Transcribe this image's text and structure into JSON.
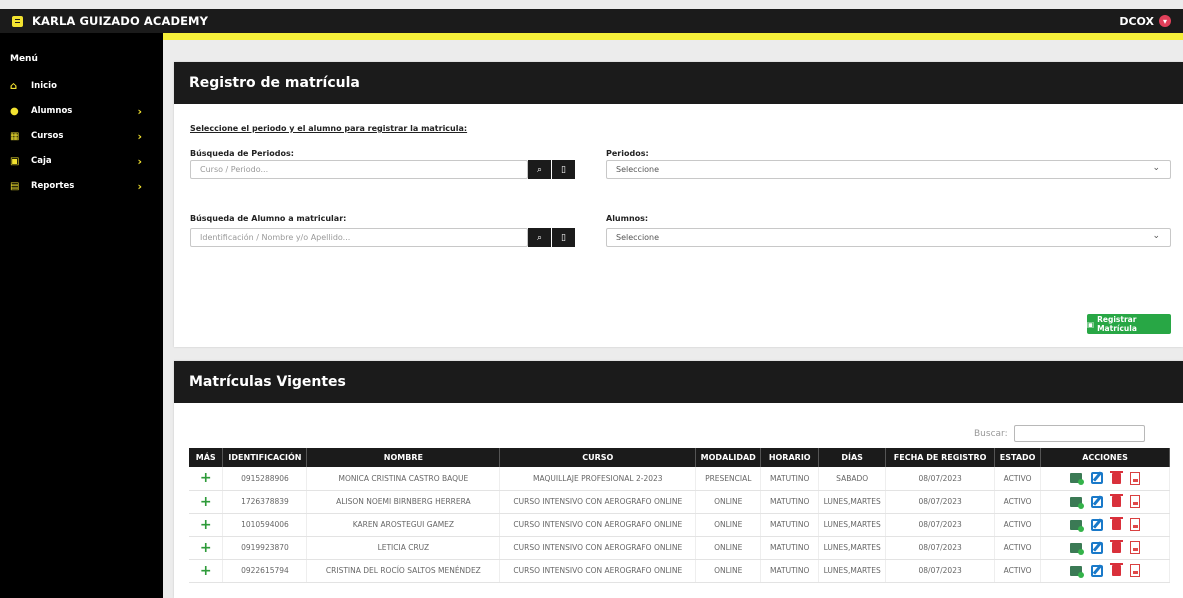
{
  "app": {
    "brand": "KARLA GUIZADO ACADEMY",
    "user": "DCOX"
  },
  "sidebar": {
    "title": "Menú",
    "items": [
      {
        "label": "Inicio",
        "icon": "home-icon",
        "chevron": false
      },
      {
        "label": "Alumnos",
        "icon": "user-icon",
        "chevron": true
      },
      {
        "label": "Cursos",
        "icon": "school-icon",
        "chevron": true
      },
      {
        "label": "Caja",
        "icon": "cash-icon",
        "chevron": true
      },
      {
        "label": "Reportes",
        "icon": "report-icon",
        "chevron": true
      }
    ]
  },
  "registro": {
    "title": "Registro de matrícula",
    "instruction": "Seleccione el periodo y el alumno para registrar la matricula:",
    "busqueda_periodos_label": "Búsqueda de Periodos:",
    "busqueda_periodos_placeholder": "Curso / Periodo...",
    "periodos_label": "Periodos:",
    "periodos_value": "Seleccione",
    "busqueda_alumno_label": "Búsqueda de Alumno a matricular:",
    "busqueda_alumno_placeholder": "Identificación / Nombre y/o Apellido...",
    "alumnos_label": "Alumnos:",
    "alumnos_value": "Seleccione",
    "register_button": "Registrar Matrícula"
  },
  "vigentes": {
    "title": "Matrículas Vigentes",
    "search_label": "Buscar:",
    "columns": [
      "MÁS",
      "IDENTIFICACIÓN",
      "NOMBRE",
      "CURSO",
      "MODALIDAD",
      "HORARIO",
      "DÍAS",
      "FECHA DE REGISTRO",
      "ESTADO",
      "ACCIONES"
    ],
    "rows": [
      {
        "id": "0915288906",
        "nombre": "MONICA CRISTINA CASTRO BAQUE",
        "curso": "MAQUILLAJE PROFESIONAL 2-2023",
        "modalidad": "PRESENCIAL",
        "horario": "MATUTINO",
        "dias": "SABADO",
        "fecha": "08/07/2023",
        "estado": "ACTIVO"
      },
      {
        "id": "1726378839",
        "nombre": "ALISON NOEMI BIRNBERG HERRERA",
        "curso": "CURSO INTENSIVO CON AEROGRAFO ONLINE",
        "modalidad": "ONLINE",
        "horario": "MATUTINO",
        "dias": "LUNES,MARTES",
        "fecha": "08/07/2023",
        "estado": "ACTIVO"
      },
      {
        "id": "1010594006",
        "nombre": "KAREN AROSTEGUI GAMEZ",
        "curso": "CURSO INTENSIVO CON AEROGRAFO ONLINE",
        "modalidad": "ONLINE",
        "horario": "MATUTINO",
        "dias": "LUNES,MARTES",
        "fecha": "08/07/2023",
        "estado": "ACTIVO"
      },
      {
        "id": "0919923870",
        "nombre": "LETICIA CRUZ",
        "curso": "CURSO INTENSIVO CON AEROGRAFO ONLINE",
        "modalidad": "ONLINE",
        "horario": "MATUTINO",
        "dias": "LUNES,MARTES",
        "fecha": "08/07/2023",
        "estado": "ACTIVO"
      },
      {
        "id": "0922615794",
        "nombre": "CRISTINA DEL ROCÍO SALTOS MENÉNDEZ",
        "curso": "CURSO INTENSIVO CON AEROGRAFO ONLINE",
        "modalidad": "ONLINE",
        "horario": "MATUTINO",
        "dias": "LUNES,MARTES",
        "fecha": "08/07/2023",
        "estado": "ACTIVO"
      }
    ]
  },
  "colors": {
    "accent_yellow": "#f5ef3a",
    "dark": "#1b1b1b",
    "success": "#28a745",
    "danger": "#d9303b"
  }
}
